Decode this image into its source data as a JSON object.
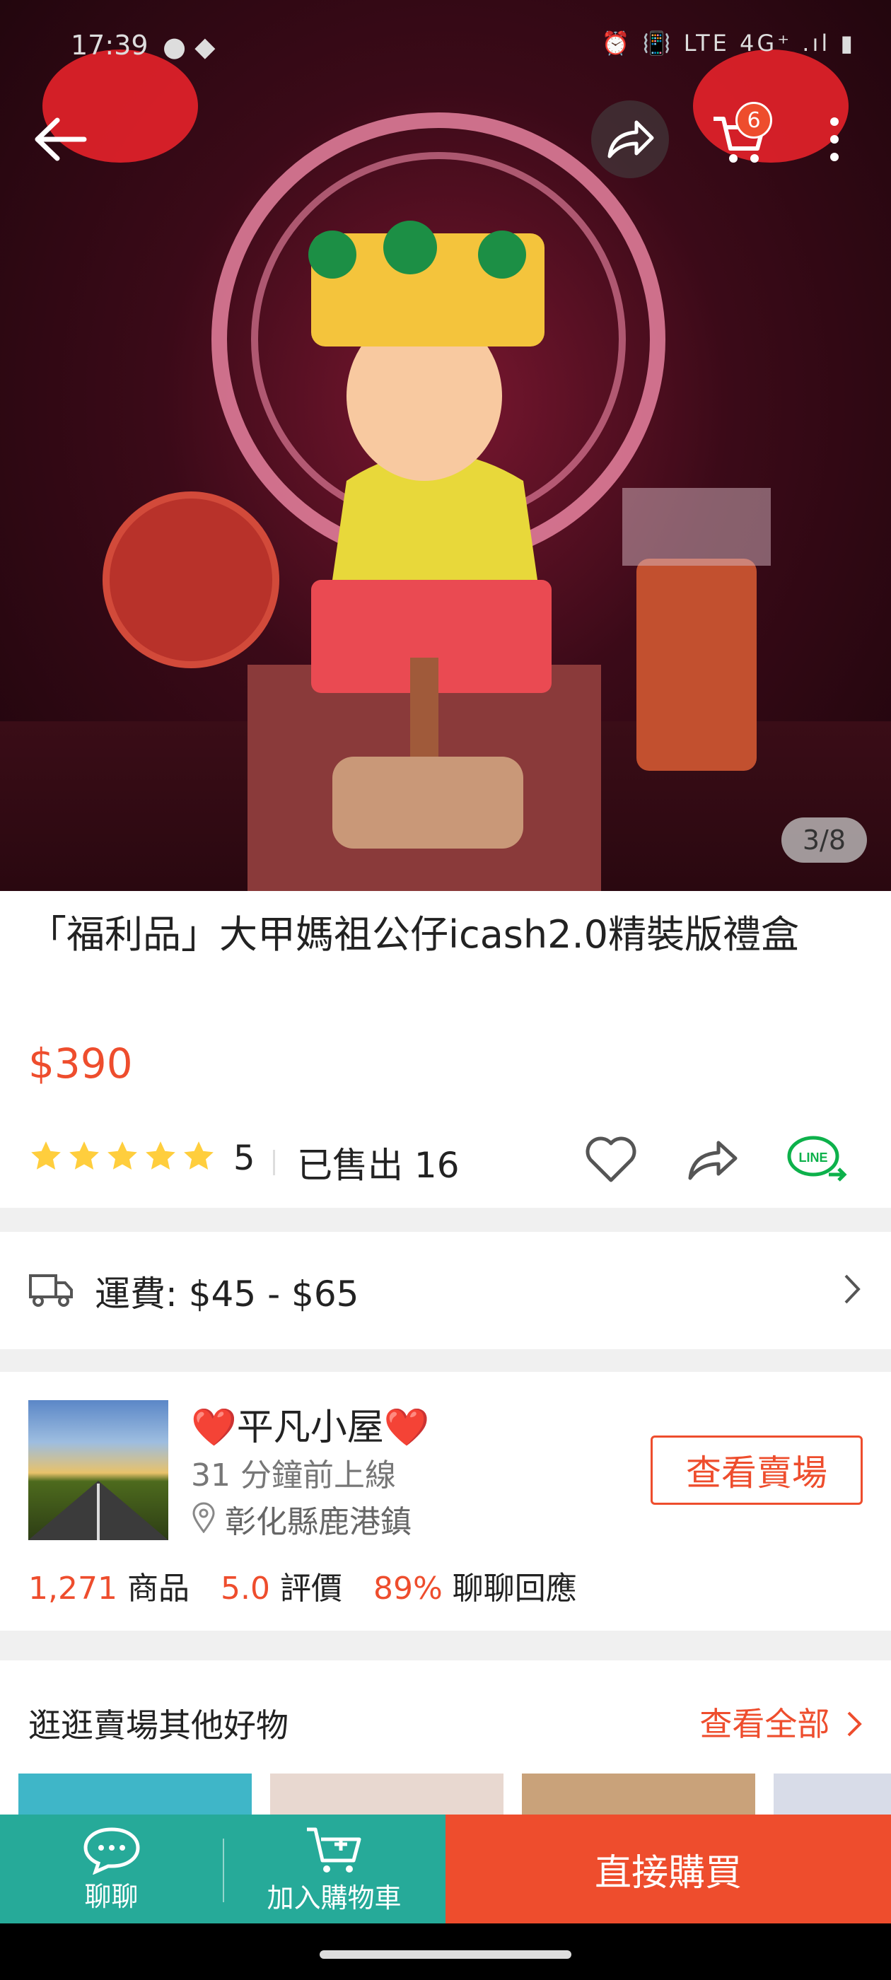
{
  "status_bar": {
    "time": "17:39",
    "system_icons": "⏰ 📳 LTE 4G⁺ .ıl ▮"
  },
  "header": {
    "cart_count": "6"
  },
  "image_counter": "3/8",
  "product": {
    "title": "「福利品」大甲媽祖公仔icash2.0精裝版禮盒",
    "price": "$390",
    "rating": "5",
    "sold": "已售出 16"
  },
  "shipping": {
    "label": "運費: $45 - $65"
  },
  "shop": {
    "name": "❤️平凡小屋❤️",
    "online": "31 分鐘前上線",
    "location": "彰化縣鹿港鎮",
    "view_button": "查看賣場",
    "products_count": "1,271",
    "products_label": "商品",
    "rating_value": "5.0",
    "rating_label": "評價",
    "chat_rate": "89%",
    "chat_label": "聊聊回應"
  },
  "more_from_shop": {
    "title": "逛逛賣場其他好物",
    "view_all": "查看全部"
  },
  "bottom_bar": {
    "chat": "聊聊",
    "add_to_cart": "加入購物車",
    "buy_now": "直接購買"
  },
  "colors": {
    "accent": "#ee4d2d",
    "teal": "#26aa99",
    "star": "#ffce3d"
  },
  "icons": [
    "back-arrow-icon",
    "share-icon",
    "cart-icon",
    "more-icon",
    "heart-icon",
    "line-share-icon",
    "truck-icon",
    "chevron-right-icon",
    "location-pin-icon",
    "chat-icon",
    "add-cart-icon"
  ]
}
